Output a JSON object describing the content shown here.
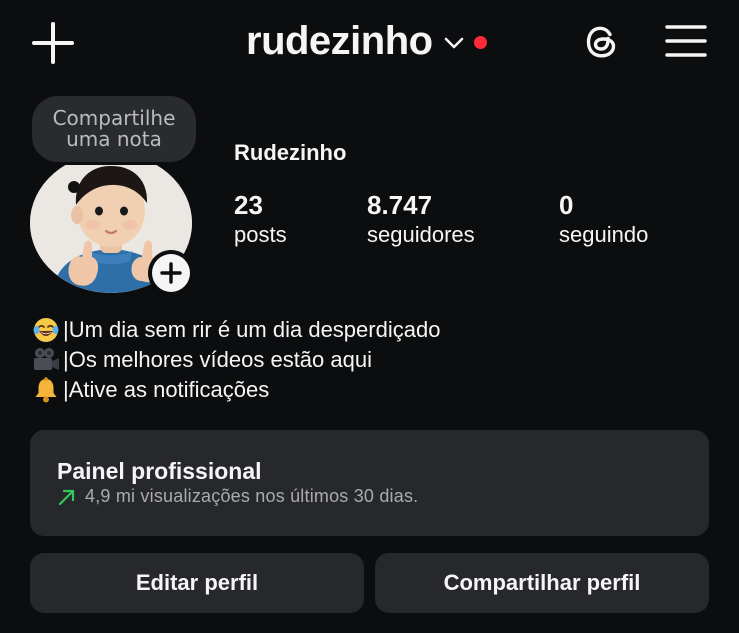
{
  "header": {
    "username": "rudezinho",
    "icons": {
      "create": "plus-icon",
      "account_switch": "chevron-down-icon",
      "notification_dot": "red-dot",
      "threads": "threads-icon",
      "menu": "hamburger-menu-icon"
    },
    "accent_dot_color": "#ff2a37"
  },
  "profile": {
    "note_prompt": "Compartilhe uma nota",
    "display_name": "Rudezinho",
    "stats": [
      {
        "value": "23",
        "label": "posts"
      },
      {
        "value": "8.747",
        "label": "seguidores"
      },
      {
        "value": "0",
        "label": "seguindo"
      }
    ]
  },
  "bio": [
    {
      "emoji": "laughing-tears-emoji",
      "text": "|Um dia sem rir é um dia desperdiçado"
    },
    {
      "emoji": "video-camera-emoji",
      "text": "|Os melhores vídeos estão aqui"
    },
    {
      "emoji": "bell-emoji",
      "text": "|Ative as notificações"
    }
  ],
  "professional_dashboard": {
    "title": "Painel profissional",
    "subtitle": "4,9 mi visualizações nos últimos 30 dias.",
    "trend_color": "#34c759"
  },
  "actions": {
    "edit_profile": "Editar perfil",
    "share_profile": "Compartilhar perfil"
  },
  "colors": {
    "background": "#0c0d0f",
    "surface": "#27282c",
    "text": "#f5f5f5",
    "muted_text": "#a9abaf"
  }
}
